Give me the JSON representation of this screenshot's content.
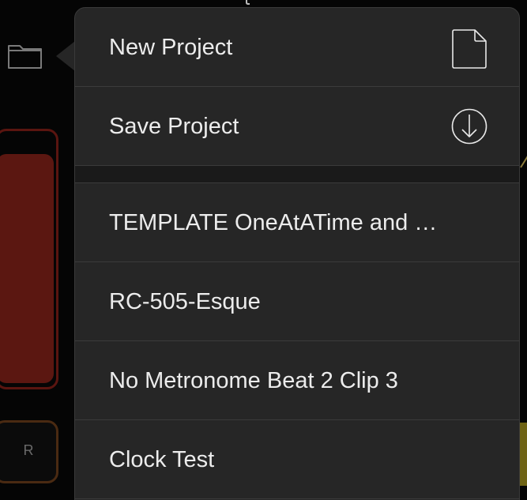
{
  "background": {
    "record_button_label": "R",
    "folder_icon": "folder-icon",
    "colors": {
      "track": "#5b1711",
      "record_border": "#4a2a12",
      "accent_right": "#6e6314"
    }
  },
  "menu": {
    "actions": [
      {
        "label": "New Project",
        "icon": "new-document-icon"
      },
      {
        "label": "Save Project",
        "icon": "download-circle-icon"
      }
    ],
    "projects": [
      {
        "label": "TEMPLATE OneAtATime and …"
      },
      {
        "label": "RC-505-Esque"
      },
      {
        "label": "No Metronome Beat 2 Clip 3"
      },
      {
        "label": "Clock Test"
      }
    ],
    "colors": {
      "background": "#262626",
      "text": "#ececec",
      "divider": "#3b3b3b"
    }
  }
}
